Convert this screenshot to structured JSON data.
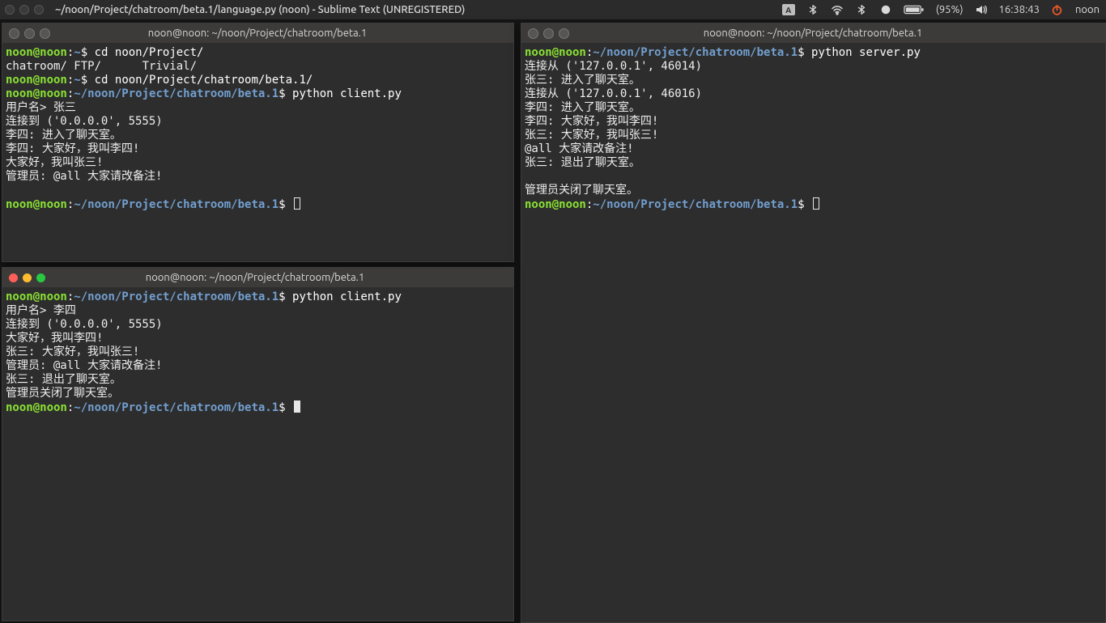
{
  "menubar": {
    "title": "~/noon/Project/chatroom/beta.1/language.py (noon) - Sublime Text (UNREGISTERED)",
    "ime": "A",
    "battery": "(95%)",
    "time": "16:38:43",
    "user": "noon"
  },
  "terminals": {
    "t1": {
      "title": "noon@noon: ~/noon/Project/chatroom/beta.1",
      "prompt_user": "noon@noon",
      "prompt_path_home": "~",
      "prompt_path_proj": "~/noon/Project/chatroom/beta.1",
      "sym": "$",
      "lines": {
        "l1_cmd": " cd noon/Project/",
        "l2": "chatroom/ FTP/      Trivial/",
        "l3_cmd": " cd noon/Project/chatroom/beta.1/",
        "l4_cmd": " python client.py",
        "l5": "用户名> 张三",
        "l6": "连接到 ('0.0.0.0', 5555)",
        "l7": "李四: 进入了聊天室。",
        "l8": "李四: 大家好，我叫李四!",
        "l9": "大家好，我叫张三!",
        "l10": "管理员: @all 大家请改备注!"
      }
    },
    "t2": {
      "title": "noon@noon: ~/noon/Project/chatroom/beta.1",
      "prompt_user": "noon@noon",
      "prompt_path_proj": "~/noon/Project/chatroom/beta.1",
      "sym": "$",
      "lines": {
        "l1_cmd": " python server.py",
        "l2": "连接从 ('127.0.0.1', 46014)",
        "l3": "张三: 进入了聊天室。",
        "l4": "连接从 ('127.0.0.1', 46016)",
        "l5": "李四: 进入了聊天室。",
        "l6": "李四: 大家好，我叫李四!",
        "l7": "张三: 大家好，我叫张三!",
        "l8": "@all 大家请改备注!",
        "l9": "张三: 退出了聊天室。",
        "l10": "",
        "l11": "管理员关闭了聊天室。"
      }
    },
    "t3": {
      "title": "noon@noon: ~/noon/Project/chatroom/beta.1",
      "prompt_user": "noon@noon",
      "prompt_path_proj": "~/noon/Project/chatroom/beta.1",
      "sym": "$",
      "lines": {
        "l1_cmd": " python client.py",
        "l2": "用户名> 李四",
        "l3": "连接到 ('0.0.0.0', 5555)",
        "l4": "大家好，我叫李四!",
        "l5": "张三: 大家好，我叫张三!",
        "l6": "管理员: @all 大家请改备注!",
        "l7": "张三: 退出了聊天室。",
        "l8": "管理员关闭了聊天室。"
      }
    }
  }
}
